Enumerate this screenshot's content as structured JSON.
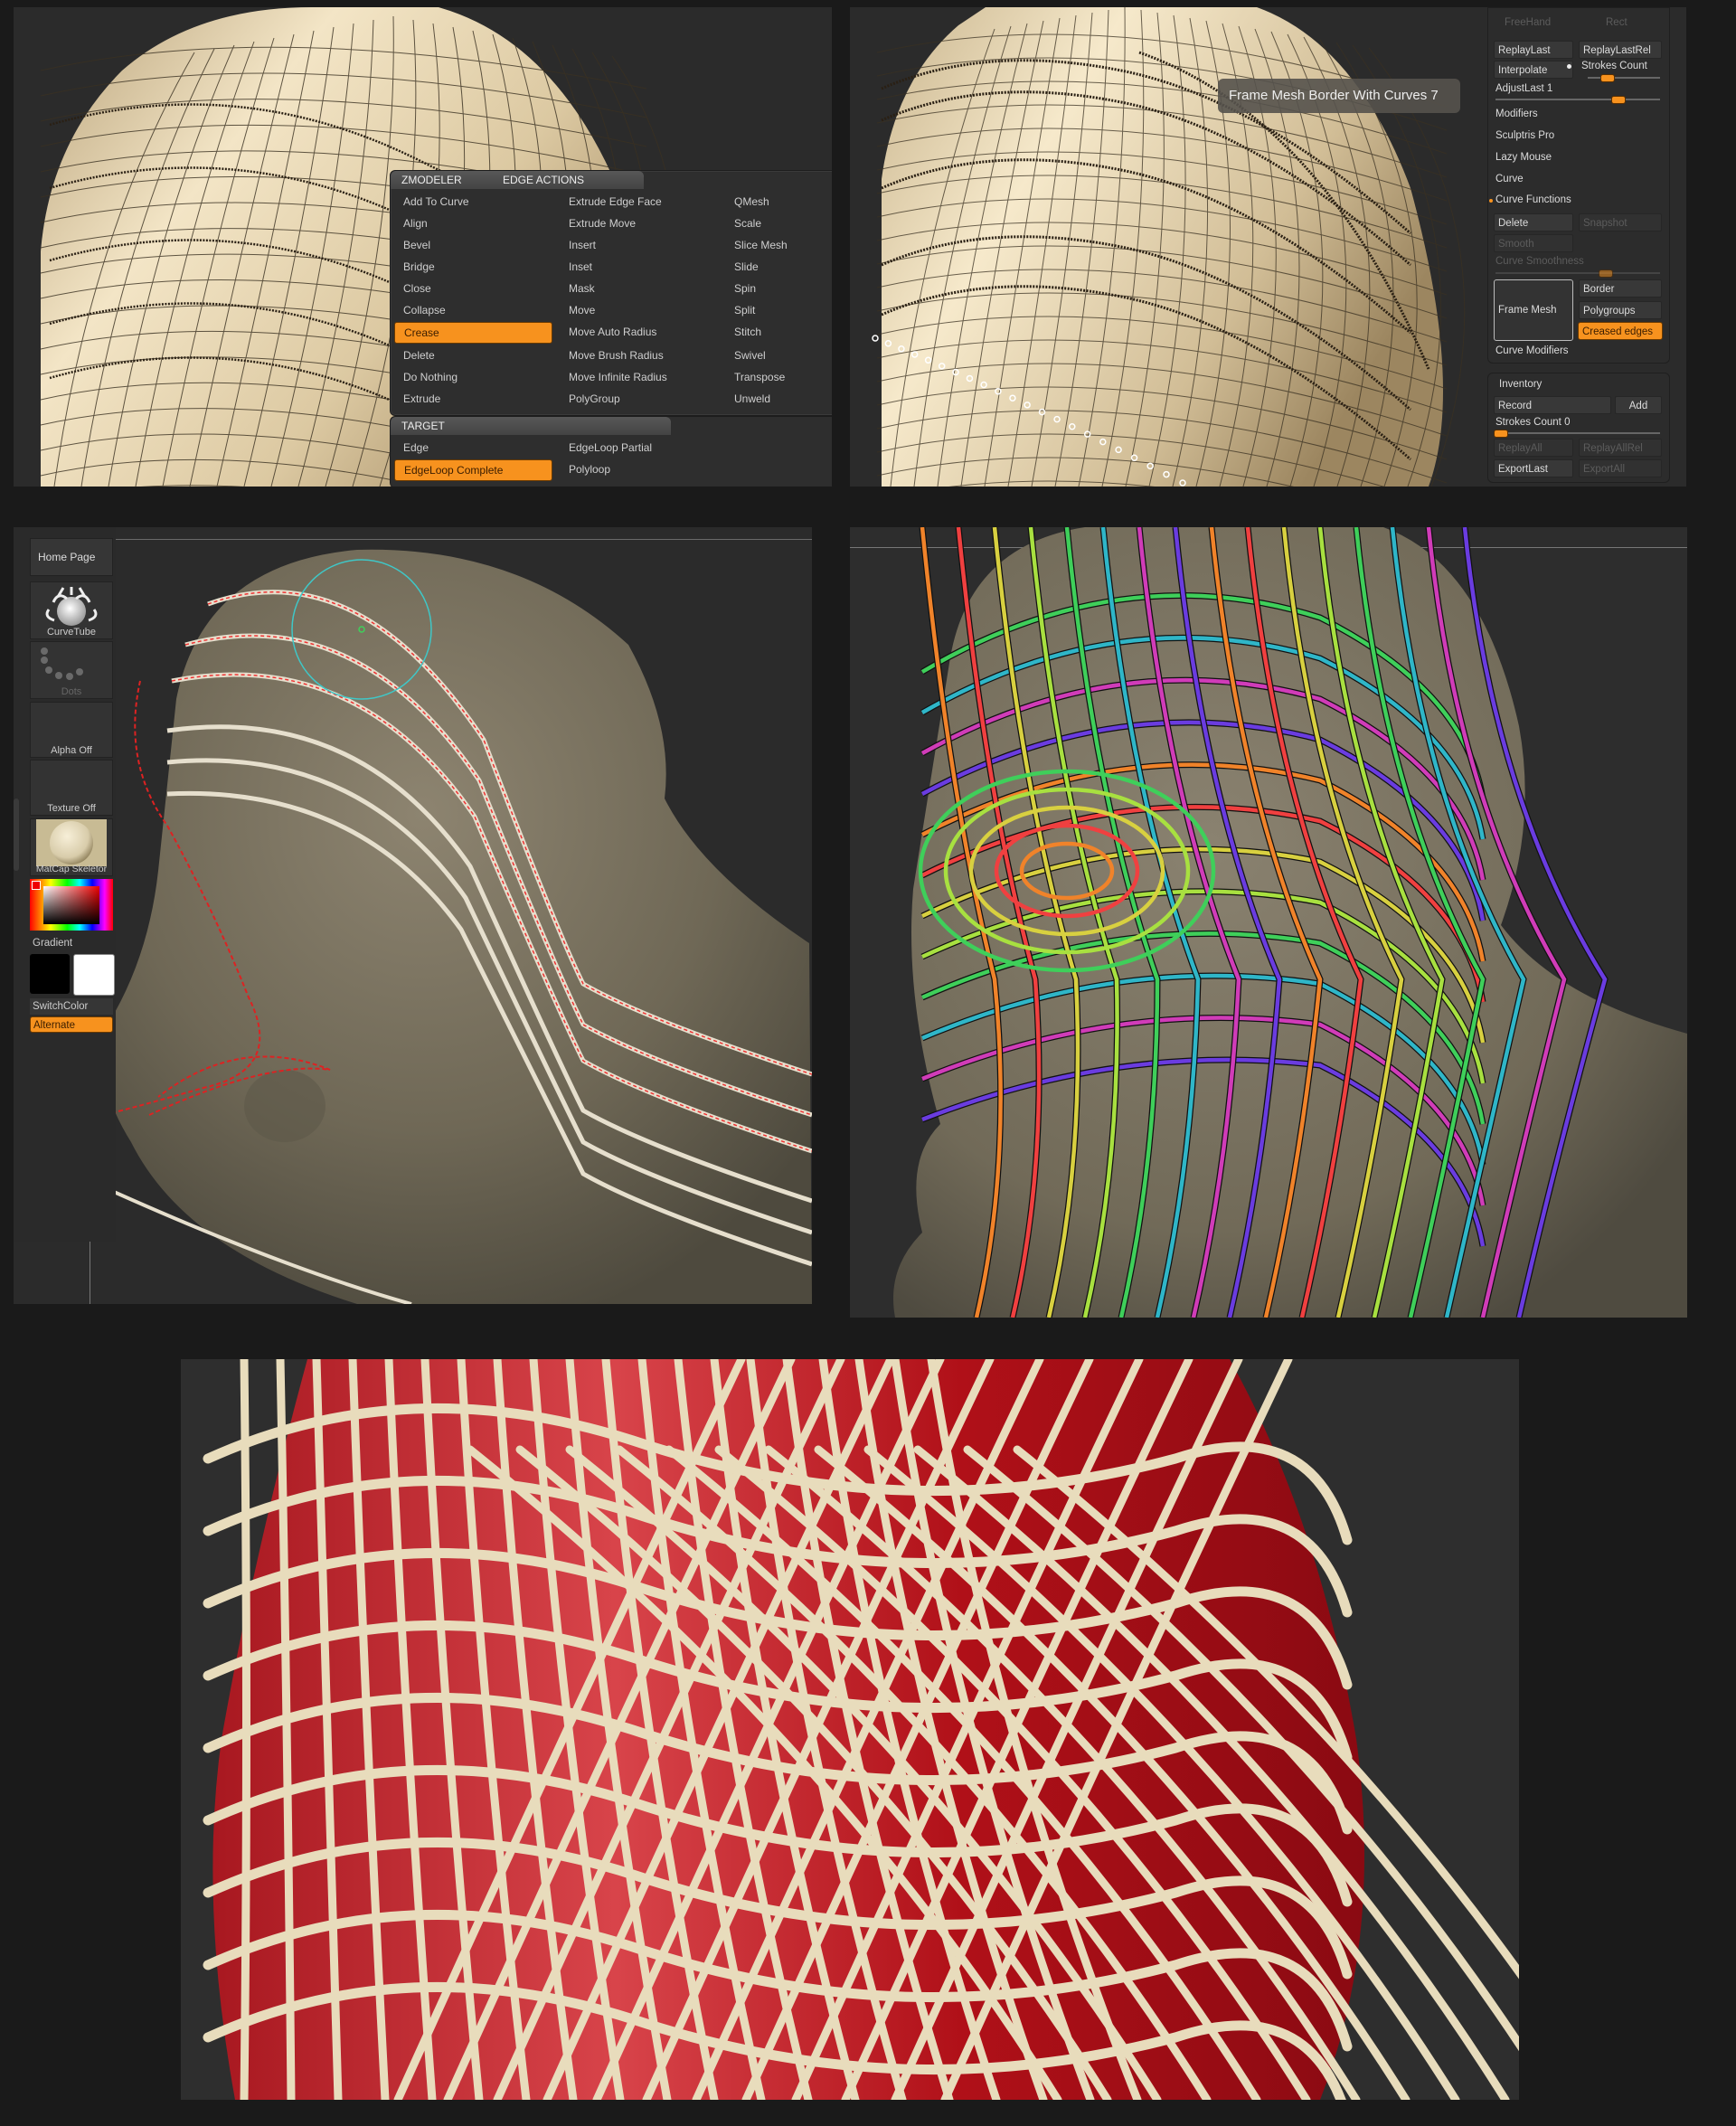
{
  "panels": {
    "top_left": {
      "zmodeler_menu": {
        "header_left": "ZMODELER",
        "header_right": "EDGE ACTIONS",
        "columns": [
          [
            "Add To Curve",
            "Align",
            "Bevel",
            "Bridge",
            "Close",
            "Collapse",
            "Crease",
            "Delete",
            "Do Nothing",
            "Extrude"
          ],
          [
            "Extrude Edge Face",
            "Extrude Move",
            "Insert",
            "Inset",
            "Mask",
            "Move",
            "Move Auto Radius",
            "Move Brush Radius",
            "Move Infinite Radius",
            "PolyGroup"
          ],
          [
            "QMesh",
            "Scale",
            "Slice Mesh",
            "Slide",
            "Spin",
            "Split",
            "Stitch",
            "Swivel",
            "Transpose",
            "Unweld"
          ]
        ],
        "selected_action": "Crease",
        "target_header": "TARGET",
        "target_columns": [
          [
            "Edge",
            "EdgeLoop Complete"
          ],
          [
            "EdgeLoop Partial",
            "Polyloop"
          ]
        ],
        "selected_target": "EdgeLoop Complete"
      }
    },
    "top_right": {
      "tooltip": "Frame Mesh Border With Curves  7",
      "stroke_palette": {
        "stroke_types": [
          "FreeHand",
          "Rect"
        ],
        "replay_last": "ReplayLast",
        "replay_last_rel": "ReplayLastRel",
        "interpolate": "Interpolate",
        "strokes_count": "Strokes Count",
        "adjust_last": "AdjustLast 1",
        "adjust_last_value": 1,
        "sections": [
          "Modifiers",
          "Sculptris Pro",
          "Lazy Mouse",
          "Curve"
        ],
        "curve_functions": "Curve Functions",
        "delete": "Delete",
        "snapshot": "Snapshot",
        "smooth": "Smooth",
        "curve_smoothness": "Curve Smoothness",
        "frame_mesh": "Frame Mesh",
        "border": "Border",
        "polygroups": "Polygroups",
        "creased_edges": "Creased edges",
        "curve_modifiers": "Curve Modifiers"
      },
      "inventory": {
        "title": "Inventory",
        "record": "Record",
        "add": "Add",
        "strokes_count_label": "Strokes Count 0",
        "strokes_count_value": 0,
        "replay_all": "ReplayAll",
        "replay_all_rel": "ReplayAllRel",
        "export_last": "ExportLast",
        "export_all": "ExportAll"
      }
    },
    "mid_left": {
      "tray": {
        "home_page": "Home Page",
        "brush": "CurveTube",
        "stroke": "Dots",
        "alpha": "Alpha Off",
        "texture": "Texture Off",
        "material": "MatCap Skeletor",
        "gradient": "Gradient",
        "switch_color": "SwitchColor",
        "alternate": "Alternate",
        "main_color": "#000000",
        "secondary_color": "#ffffff"
      }
    },
    "mid_right": {
      "curve_colors": [
        "#3fcf5a",
        "#2fb6c8",
        "#d03cb8",
        "#6a3ce0",
        "#f0832a",
        "#f04040",
        "#d8d040",
        "#a8e040"
      ]
    },
    "bottom": {
      "mesh_color": "#b8141c",
      "tube_color": "#e8dcbc"
    }
  },
  "colors": {
    "accent": "#f7921e",
    "background": "#1a1a1a",
    "viewport": "#2b2b2b"
  }
}
